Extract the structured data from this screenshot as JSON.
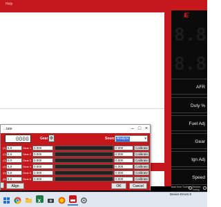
{
  "menubar": {
    "help_label": "Help"
  },
  "panel": {
    "logo_text": "IE",
    "segments": [
      "8.8",
      "8.8"
    ],
    "gauges": [
      {
        "label": "AFR"
      },
      {
        "label": "Duty %"
      },
      {
        "label": "Fuel Adj"
      },
      {
        "label": "Gear"
      },
      {
        "label": "Ign Adj"
      },
      {
        "label": "Speed"
      }
    ],
    "modes": [
      {
        "label": "AutoTune Tuning"
      },
      {
        "label": "Session Tuning"
      }
    ]
  },
  "dialog": {
    "title": "...tate",
    "counter_value": "0000",
    "gear_label": "Gear",
    "source_label": "Source",
    "source_value": "Analyze",
    "rows": [
      {
        "axis": "(1)",
        "value_a": "5.0",
        "gear": "Gear 1",
        "value_b": "0.000",
        "value_c": "0.000",
        "button": "Calibrate"
      },
      {
        "axis": "(2)",
        "value_a": "5.0",
        "gear": "Gear 2",
        "value_b": "0.000",
        "value_c": "0.000",
        "button": "Calibrate"
      },
      {
        "axis": "(3)",
        "value_a": "5.0",
        "gear": "Gear 3",
        "value_b": "0.000",
        "value_c": "0.000",
        "button": "Calibrate"
      },
      {
        "axis": "(4)",
        "value_a": "5.0",
        "gear": "Gear 4",
        "value_b": "0.000",
        "value_c": "0.000",
        "button": "Calibrate"
      },
      {
        "axis": "(5)",
        "value_a": "5.0",
        "gear": "Gear 5",
        "value_b": "0.000",
        "value_c": "0.000",
        "button": "Calibrate"
      },
      {
        "axis": "(6)",
        "value_a": "5.0",
        "gear": "Gear 6",
        "value_b": "0.000",
        "value_c": "0.000",
        "button": "Calibrate"
      }
    ],
    "align_label": "Align",
    "ok_label": "OK",
    "cancel_label": "Cancel"
  },
  "status": {
    "device_text": "Device Errors 0"
  },
  "colors": {
    "brand_red": "#c5171c",
    "panel_black": "#0b0b0b",
    "taskbar": "#dfe6ef"
  },
  "taskbar_icons": [
    "windows-start-icon",
    "chrome-icon",
    "file-explorer-icon",
    "excel-icon",
    "camera-app-icon",
    "firefox-icon",
    "tuning-app-icon",
    "settings-icon"
  ]
}
